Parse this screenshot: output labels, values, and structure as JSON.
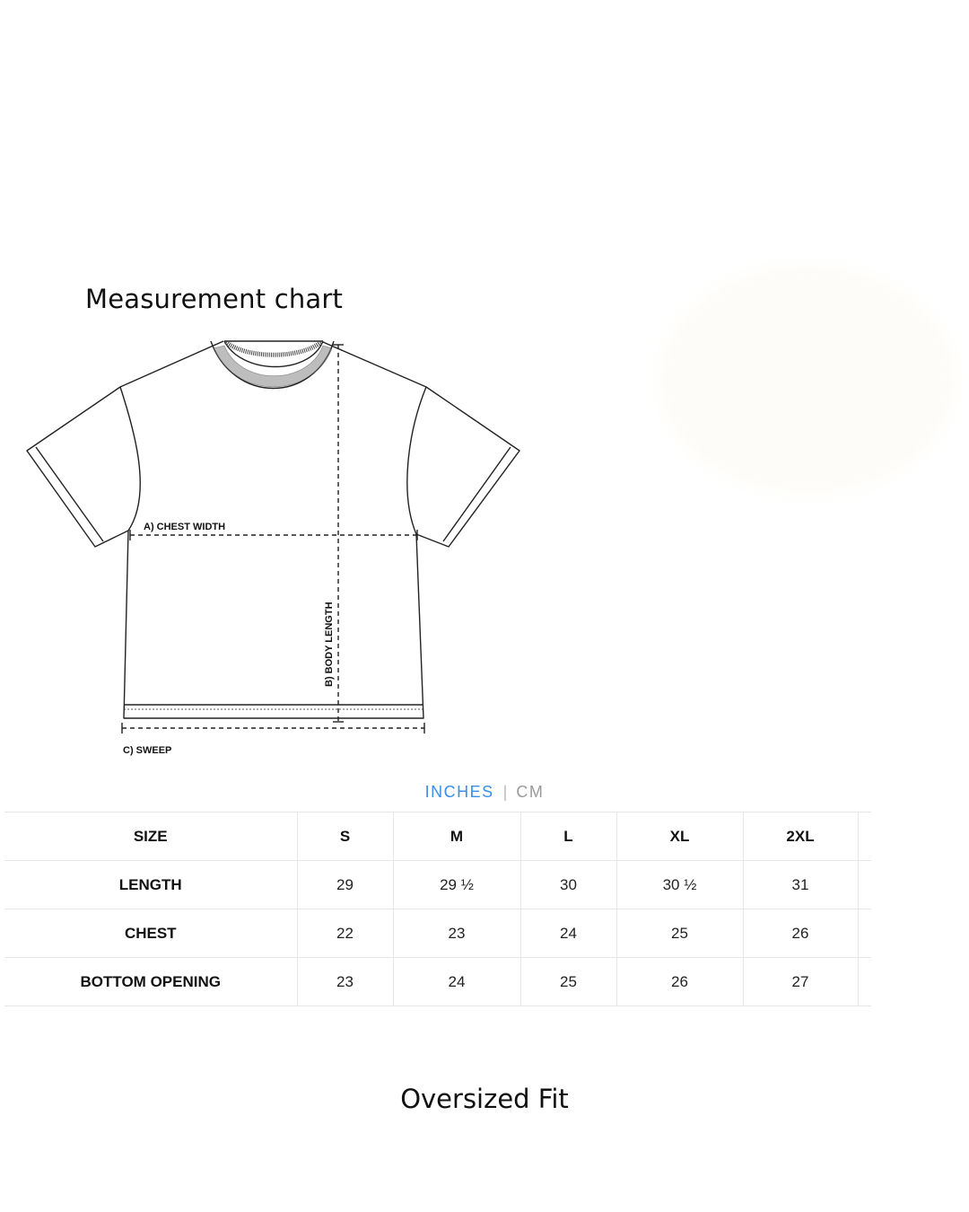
{
  "title": "Measurement chart",
  "diagram": {
    "chest_label": "A) CHEST WIDTH",
    "length_label": "B) BODY LENGTH",
    "sweep_label": "C) SWEEP"
  },
  "units": {
    "active": "INCHES",
    "separator": "|",
    "inactive": "CM",
    "active_color": "#3b8fe5"
  },
  "table": {
    "header": [
      "SIZE",
      "S",
      "M",
      "L",
      "XL",
      "2XL"
    ],
    "rows": [
      [
        "LENGTH",
        "29",
        "29 ½",
        "30",
        "30 ½",
        "31"
      ],
      [
        "CHEST",
        "22",
        "23",
        "24",
        "25",
        "26"
      ],
      [
        "BOTTOM OPENING",
        "23",
        "24",
        "25",
        "26",
        "27"
      ]
    ]
  },
  "footer": "Oversized Fit"
}
